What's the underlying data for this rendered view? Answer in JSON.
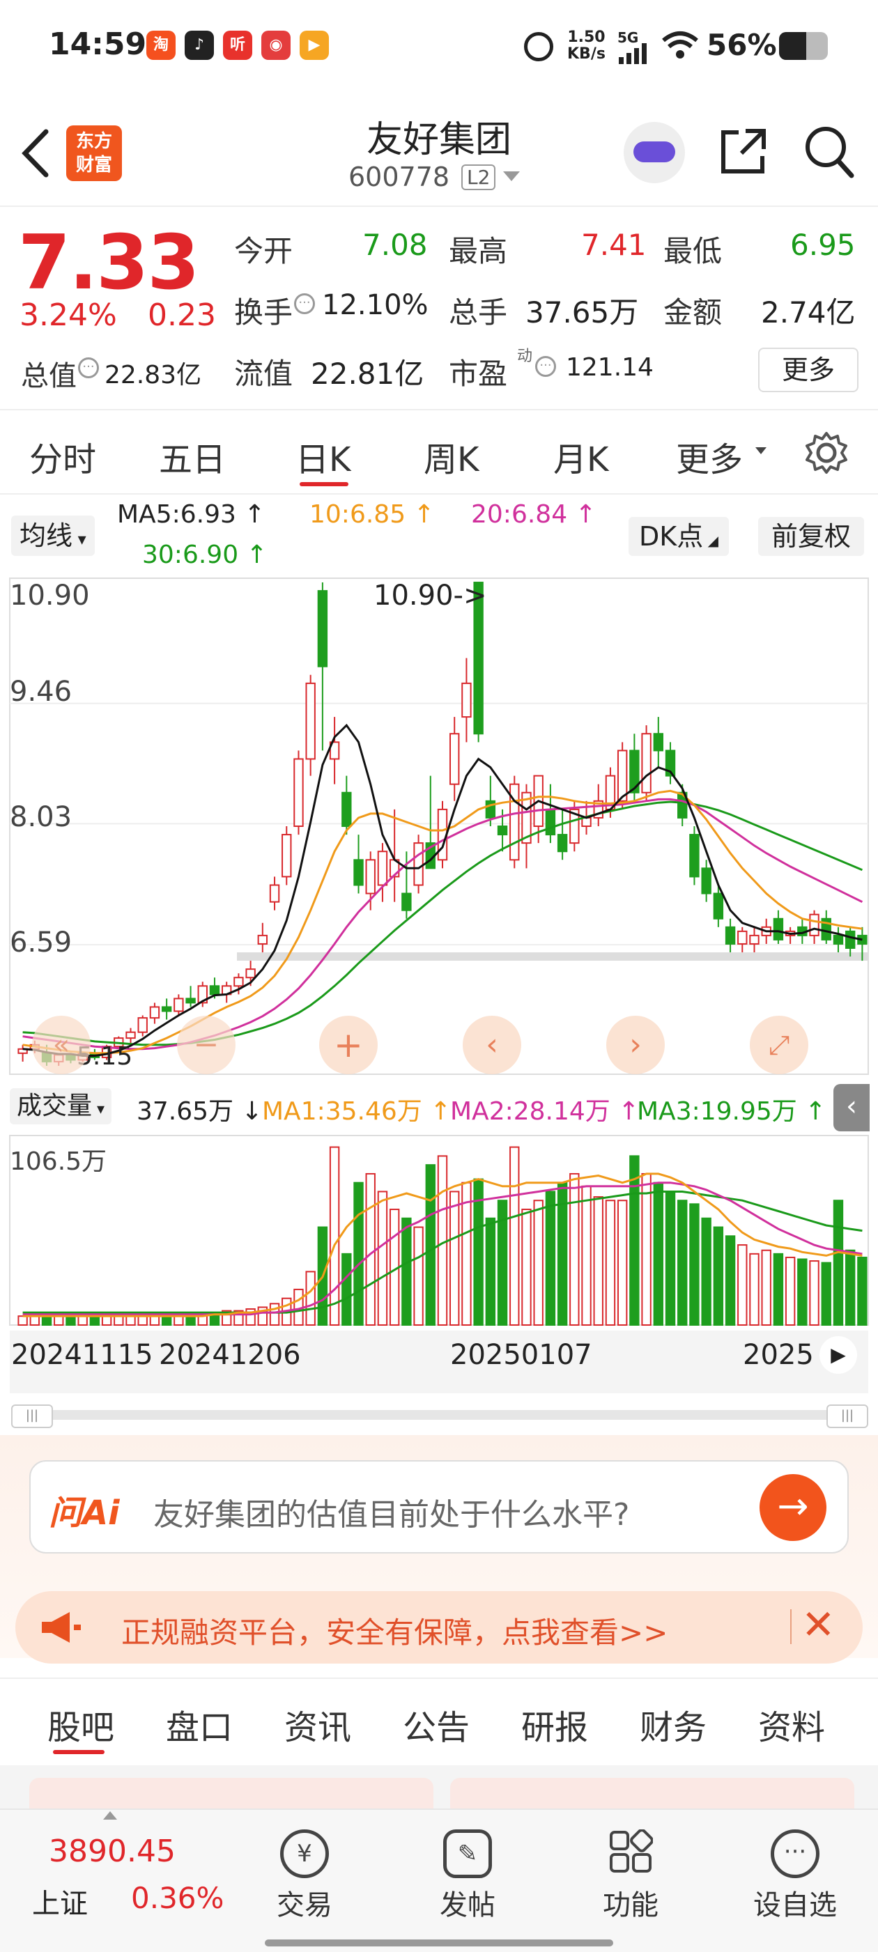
{
  "status_bar": {
    "time": "14:59",
    "net_speed_value": "1.50",
    "net_speed_unit": "KB/s",
    "network": "5G",
    "battery": "56%",
    "app_icons": [
      "taobao-icon",
      "douyin-icon",
      "ting-icon",
      "pdd-icon",
      "video-icon"
    ]
  },
  "header": {
    "logo_line1": "东方",
    "logo_line2": "财富",
    "stock_name": "友好集团",
    "stock_code": "600778",
    "level_badge": "L2"
  },
  "quote": {
    "price": "7.33",
    "change_pct": "3.24%",
    "change_abs": "0.23",
    "open_label": "今开",
    "open_value": "7.08",
    "high_label": "最高",
    "high_value": "7.41",
    "low_label": "最低",
    "low_value": "6.95",
    "turnover_label": "换手",
    "turnover_value": "12.10%",
    "volume_label": "总手",
    "volume_value": "37.65万",
    "amount_label": "金额",
    "amount_value": "2.74亿",
    "mktcap_label": "总值",
    "mktcap_value": "22.83亿",
    "float_label": "流值",
    "float_value": "22.81亿",
    "pe_label": "市盈",
    "pe_sup": "动",
    "pe_value": "121.14",
    "more_button": "更多"
  },
  "period_tabs": [
    "分时",
    "五日",
    "日K",
    "周K",
    "月K",
    "更多"
  ],
  "active_tab": "日K",
  "ma_bar": {
    "selector": "均线",
    "ma5": "MA5:6.93 ↑",
    "ma10": "10:6.85 ↑",
    "ma20": "20:6.84 ↑",
    "ma30": "30:6.90 ↑",
    "dk_button": "DK点",
    "adjust_button": "前复权"
  },
  "chart_data": {
    "type": "candlestick",
    "y_ticks": [
      "10.90",
      "9.46",
      "8.03",
      "6.59"
    ],
    "low_label": "5.15",
    "high_annotation": "10.90->",
    "x_ticks": [
      "20241115",
      "20241206",
      "20250107",
      "2025"
    ],
    "candles": [
      [
        5.3,
        5.4,
        5.2,
        5.35
      ],
      [
        5.35,
        5.45,
        5.3,
        5.4
      ],
      [
        5.3,
        5.4,
        5.15,
        5.2
      ],
      [
        5.2,
        5.3,
        5.15,
        5.28
      ],
      [
        5.28,
        5.3,
        5.18,
        5.22
      ],
      [
        5.22,
        5.32,
        5.2,
        5.3
      ],
      [
        5.3,
        5.35,
        5.22,
        5.25
      ],
      [
        5.25,
        5.4,
        5.22,
        5.38
      ],
      [
        5.38,
        5.5,
        5.35,
        5.48
      ],
      [
        5.48,
        5.6,
        5.42,
        5.55
      ],
      [
        5.55,
        5.75,
        5.5,
        5.72
      ],
      [
        5.72,
        5.9,
        5.65,
        5.85
      ],
      [
        5.85,
        5.95,
        5.7,
        5.8
      ],
      [
        5.8,
        6.0,
        5.75,
        5.95
      ],
      [
        5.95,
        6.1,
        5.85,
        5.9
      ],
      [
        5.9,
        6.15,
        5.85,
        6.1
      ],
      [
        6.1,
        6.2,
        5.95,
        6.0
      ],
      [
        6.0,
        6.15,
        5.9,
        6.1
      ],
      [
        6.1,
        6.25,
        6.0,
        6.2
      ],
      [
        6.2,
        6.4,
        6.1,
        6.3
      ],
      [
        6.6,
        6.85,
        6.5,
        6.7
      ],
      [
        7.1,
        7.4,
        7.0,
        7.3
      ],
      [
        7.4,
        8.0,
        7.3,
        7.9
      ],
      [
        8.0,
        8.9,
        7.9,
        8.8
      ],
      [
        8.8,
        9.8,
        8.6,
        9.7
      ],
      [
        10.8,
        10.9,
        8.9,
        9.9
      ],
      [
        8.8,
        9.3,
        8.5,
        9.0
      ],
      [
        8.4,
        8.6,
        7.9,
        8.0
      ],
      [
        7.6,
        7.9,
        7.2,
        7.3
      ],
      [
        7.2,
        7.7,
        7.0,
        7.6
      ],
      [
        7.3,
        7.8,
        7.1,
        7.7
      ],
      [
        7.4,
        8.2,
        7.1,
        7.6
      ],
      [
        7.2,
        7.7,
        6.9,
        7.0
      ],
      [
        7.3,
        7.9,
        7.2,
        7.8
      ],
      [
        7.8,
        8.6,
        7.6,
        7.5
      ],
      [
        7.6,
        8.3,
        7.5,
        8.2
      ],
      [
        8.5,
        9.3,
        8.3,
        9.1
      ],
      [
        9.3,
        10.0,
        9.0,
        9.7
      ],
      [
        10.9,
        10.9,
        9.0,
        9.1
      ],
      [
        8.3,
        8.6,
        8.0,
        8.1
      ],
      [
        8.0,
        8.2,
        7.7,
        7.9
      ],
      [
        7.6,
        8.6,
        7.5,
        8.5
      ],
      [
        7.8,
        8.5,
        7.5,
        8.4
      ],
      [
        8.0,
        8.6,
        7.8,
        8.6
      ],
      [
        8.2,
        8.5,
        7.8,
        7.9
      ],
      [
        7.9,
        8.2,
        7.6,
        7.7
      ],
      [
        7.8,
        8.3,
        7.7,
        8.2
      ],
      [
        8.0,
        8.3,
        7.9,
        8.1
      ],
      [
        8.1,
        8.5,
        8.0,
        8.3
      ],
      [
        8.2,
        8.7,
        8.1,
        8.6
      ],
      [
        8.3,
        9.0,
        8.2,
        8.9
      ],
      [
        8.9,
        9.1,
        8.3,
        8.4
      ],
      [
        8.4,
        9.2,
        8.3,
        9.1
      ],
      [
        9.1,
        9.3,
        8.7,
        8.9
      ],
      [
        8.9,
        9.0,
        8.5,
        8.6
      ],
      [
        8.4,
        8.5,
        8.0,
        8.1
      ],
      [
        7.9,
        8.0,
        7.3,
        7.4
      ],
      [
        7.5,
        7.6,
        7.1,
        7.2
      ],
      [
        7.2,
        7.3,
        6.8,
        6.9
      ],
      [
        6.8,
        6.9,
        6.5,
        6.6
      ],
      [
        6.6,
        6.8,
        6.5,
        6.75
      ],
      [
        6.6,
        6.8,
        6.5,
        6.7
      ],
      [
        6.7,
        6.9,
        6.6,
        6.8
      ],
      [
        6.9,
        7.0,
        6.6,
        6.65
      ],
      [
        6.7,
        6.8,
        6.6,
        6.75
      ],
      [
        6.8,
        6.9,
        6.6,
        6.7
      ],
      [
        6.7,
        7.0,
        6.6,
        6.95
      ],
      [
        6.9,
        7.0,
        6.6,
        6.65
      ],
      [
        6.7,
        6.8,
        6.5,
        6.6
      ],
      [
        6.75,
        6.8,
        6.45,
        6.55
      ],
      [
        6.7,
        6.8,
        6.4,
        6.6
      ]
    ],
    "ma5": [
      5.35,
      5.34,
      5.31,
      5.29,
      5.29,
      5.27,
      5.27,
      5.29,
      5.33,
      5.39,
      5.47,
      5.57,
      5.66,
      5.75,
      5.83,
      5.92,
      5.99,
      6.0,
      6.06,
      6.14,
      6.3,
      6.52,
      6.88,
      7.4,
      8.05,
      8.73,
      9.06,
      9.2,
      9.0,
      8.5,
      7.9,
      7.6,
      7.5,
      7.5,
      7.6,
      7.75,
      8.2,
      8.6,
      8.8,
      8.7,
      8.5,
      8.3,
      8.2,
      8.3,
      8.25,
      8.2,
      8.15,
      8.1,
      8.15,
      8.2,
      8.35,
      8.45,
      8.6,
      8.7,
      8.65,
      8.45,
      8.1,
      7.7,
      7.3,
      7.0,
      6.85,
      6.8,
      6.75,
      6.75,
      6.72,
      6.73,
      6.78,
      6.75,
      6.72,
      6.68,
      6.65
    ],
    "ma10": [
      5.4,
      5.38,
      5.36,
      5.34,
      5.32,
      5.31,
      5.3,
      5.3,
      5.31,
      5.33,
      5.36,
      5.42,
      5.48,
      5.55,
      5.62,
      5.7,
      5.78,
      5.85,
      5.91,
      5.98,
      6.08,
      6.22,
      6.42,
      6.68,
      7.0,
      7.35,
      7.7,
      7.95,
      8.1,
      8.15,
      8.15,
      8.1,
      8.05,
      8.0,
      7.95,
      7.95,
      8.0,
      8.1,
      8.2,
      8.25,
      8.28,
      8.3,
      8.32,
      8.35,
      8.35,
      8.33,
      8.3,
      8.28,
      8.27,
      8.27,
      8.28,
      8.3,
      8.35,
      8.4,
      8.42,
      8.38,
      8.25,
      8.08,
      7.88,
      7.68,
      7.5,
      7.35,
      7.2,
      7.08,
      6.98,
      6.9,
      6.87,
      6.85,
      6.82,
      6.8,
      6.78
    ],
    "ma20": [
      5.5,
      5.48,
      5.46,
      5.44,
      5.42,
      5.4,
      5.38,
      5.37,
      5.36,
      5.35,
      5.35,
      5.36,
      5.38,
      5.4,
      5.43,
      5.47,
      5.51,
      5.56,
      5.61,
      5.67,
      5.74,
      5.83,
      5.94,
      6.07,
      6.23,
      6.41,
      6.6,
      6.8,
      6.98,
      7.13,
      7.28,
      7.42,
      7.55,
      7.66,
      7.75,
      7.83,
      7.9,
      7.97,
      8.03,
      8.08,
      8.12,
      8.15,
      8.17,
      8.19,
      8.2,
      8.21,
      8.22,
      8.23,
      8.24,
      8.25,
      8.26,
      8.28,
      8.3,
      8.32,
      8.32,
      8.3,
      8.25,
      8.17,
      8.07,
      7.97,
      7.87,
      7.77,
      7.68,
      7.6,
      7.52,
      7.45,
      7.38,
      7.31,
      7.24,
      7.17,
      7.1
    ],
    "ma30": [
      5.55,
      5.54,
      5.52,
      5.5,
      5.48,
      5.46,
      5.44,
      5.43,
      5.42,
      5.41,
      5.4,
      5.4,
      5.4,
      5.41,
      5.42,
      5.44,
      5.46,
      5.49,
      5.52,
      5.56,
      5.6,
      5.65,
      5.71,
      5.78,
      5.87,
      5.98,
      6.1,
      6.23,
      6.37,
      6.5,
      6.63,
      6.76,
      6.88,
      7.0,
      7.12,
      7.24,
      7.35,
      7.46,
      7.56,
      7.65,
      7.73,
      7.8,
      7.87,
      7.93,
      7.98,
      8.03,
      8.07,
      8.11,
      8.15,
      8.18,
      8.21,
      8.24,
      8.26,
      8.28,
      8.29,
      8.28,
      8.26,
      8.23,
      8.19,
      8.14,
      8.08,
      8.02,
      7.96,
      7.9,
      7.84,
      7.78,
      7.72,
      7.66,
      7.6,
      7.54,
      7.48
    ]
  },
  "volume": {
    "selector": "成交量",
    "current": "37.65万 ↓",
    "ma1": "MA1:35.46万 ↑",
    "ma2": "MA2:28.14万 ↑",
    "ma3": "MA3:19.95万 ↑",
    "max_label": "106.5万",
    "bars": [
      5,
      5,
      5,
      5,
      5,
      5,
      5,
      5,
      5,
      5,
      5,
      5,
      5,
      5,
      6,
      6,
      7,
      8,
      8,
      9,
      10,
      12,
      15,
      20,
      30,
      55,
      100,
      40,
      80,
      85,
      75,
      65,
      60,
      55,
      90,
      95,
      75,
      80,
      82,
      60,
      70,
      100,
      65,
      70,
      75,
      80,
      85,
      78,
      72,
      70,
      70,
      95,
      85,
      80,
      75,
      70,
      68,
      60,
      55,
      50,
      45,
      40,
      42,
      40,
      38,
      37,
      36,
      35,
      70,
      42,
      38
    ],
    "ma1_line": [
      5,
      5,
      5,
      5,
      5,
      5,
      5,
      5,
      5,
      5,
      5,
      5,
      5,
      5,
      5,
      5,
      6,
      6,
      7,
      7,
      8,
      9,
      11,
      14,
      19,
      27,
      45,
      55,
      62,
      66,
      70,
      72,
      74,
      72,
      70,
      75,
      78,
      80,
      82,
      80,
      78,
      78,
      80,
      80,
      80,
      80,
      82,
      83,
      84,
      82,
      80,
      82,
      85,
      85,
      83,
      80,
      75,
      70,
      65,
      58,
      52,
      48,
      46,
      44,
      43,
      41,
      40,
      39,
      41,
      40,
      39
    ],
    "ma2_line": [
      6,
      6,
      6,
      6,
      6,
      6,
      6,
      6,
      6,
      6,
      6,
      6,
      6,
      6,
      6,
      6,
      6,
      6,
      6,
      6,
      7,
      7,
      8,
      9,
      11,
      14,
      20,
      27,
      34,
      40,
      45,
      50,
      55,
      58,
      62,
      65,
      67,
      69,
      70,
      71,
      72,
      73,
      74,
      75,
      76,
      77,
      77,
      78,
      78,
      78,
      78,
      78,
      79,
      80,
      80,
      79,
      78,
      76,
      73,
      70,
      66,
      62,
      58,
      54,
      51,
      48,
      45,
      43,
      42,
      41,
      40
    ],
    "ma3_line": [
      7,
      7,
      7,
      7,
      7,
      7,
      7,
      7,
      7,
      7,
      7,
      7,
      7,
      7,
      7,
      7,
      7,
      7,
      7,
      7,
      7,
      7,
      7,
      8,
      9,
      10,
      12,
      15,
      19,
      23,
      27,
      31,
      35,
      38,
      42,
      46,
      49,
      52,
      55,
      57,
      59,
      61,
      63,
      65,
      67,
      68,
      69,
      70,
      71,
      72,
      73,
      74,
      74,
      75,
      75,
      75,
      74,
      73,
      72,
      71,
      70,
      68,
      66,
      64,
      62,
      60,
      58,
      56,
      55,
      54,
      53
    ]
  },
  "toolbar_icons": [
    "prev-page-icon",
    "zoom-out-icon",
    "zoom-in-icon",
    "step-left-icon",
    "step-right-icon",
    "fullscreen-icon"
  ],
  "ai_box": {
    "brand": "问Ai",
    "question": "友好集团的估值目前处于什么水平?"
  },
  "promo": {
    "text": "正规融资平台，安全有保障，点我查看>>"
  },
  "sub_tabs": [
    "股吧",
    "盘口",
    "资讯",
    "公告",
    "研报",
    "财务",
    "资料"
  ],
  "bottom_nav": {
    "index_value": "3890.45",
    "index_name": "上证",
    "index_change": "0.36%",
    "items": [
      "交易",
      "发帖",
      "功能",
      "设自选"
    ]
  }
}
